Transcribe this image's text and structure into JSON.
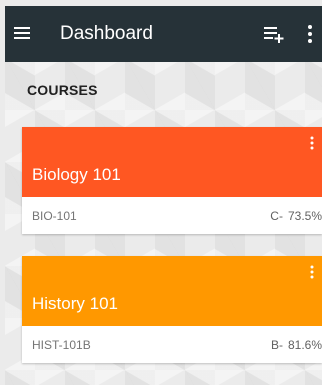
{
  "app_bar": {
    "title": "Dashboard",
    "background_color": "#263238",
    "icons": [
      "menu-icon",
      "playlist-add-icon",
      "more-vert-icon"
    ]
  },
  "section": {
    "header": "COURSES"
  },
  "courses": [
    {
      "name": "Biology 101",
      "code": "BIO-101",
      "grade_letter": "C-",
      "grade_percent": "73.5%",
      "color": "#ff5722"
    },
    {
      "name": "History 101",
      "code": "HIST-101B",
      "grade_letter": "B-",
      "grade_percent": "81.6%",
      "color": "#ff9800"
    }
  ]
}
